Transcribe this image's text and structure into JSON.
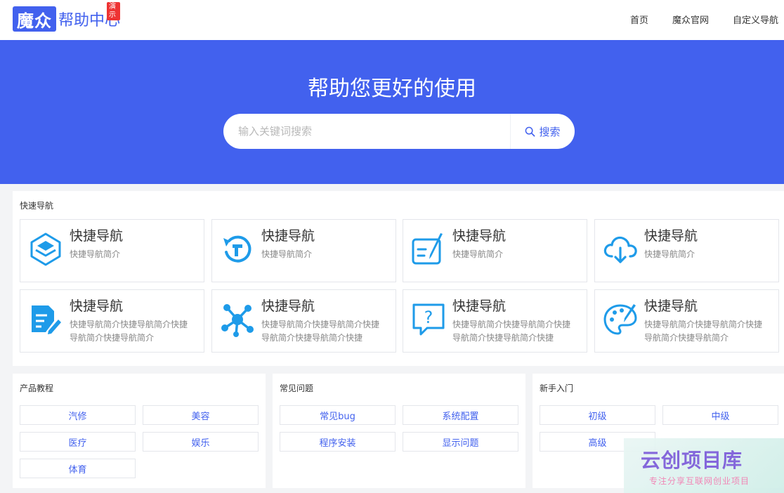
{
  "header": {
    "logo_box": "魔众",
    "logo_text": "帮助中心",
    "logo_badge": "演示",
    "nav": [
      "首页",
      "魔众官网",
      "自定义导航"
    ]
  },
  "hero": {
    "title": "帮助您更好的使用",
    "search_placeholder": "输入关键词搜索",
    "search_button": "搜索"
  },
  "quick_nav": {
    "title": "快速导航",
    "cards": [
      {
        "title": "快捷导航",
        "desc": "快捷导航简介",
        "icon": "layers-icon"
      },
      {
        "title": "快捷导航",
        "desc": "快捷导航简介",
        "icon": "refresh-icon"
      },
      {
        "title": "快捷导航",
        "desc": "快捷导航简介",
        "icon": "edit-form-icon"
      },
      {
        "title": "快捷导航",
        "desc": "快捷导航简介",
        "icon": "cloud-download-icon"
      },
      {
        "title": "快捷导航",
        "desc": "快捷导航简介快捷导航简介快捷导航简介快捷导航简介",
        "icon": "document-pen-icon"
      },
      {
        "title": "快捷导航",
        "desc": "快捷导航简介快捷导航简介快捷导航简介快捷导航简介快捷",
        "icon": "network-icon"
      },
      {
        "title": "快捷导航",
        "desc": "快捷导航简介快捷导航简介快捷导航简介快捷导航简介快捷",
        "icon": "question-bubble-icon"
      },
      {
        "title": "快捷导航",
        "desc": "快捷导航简介快捷导航简介快捷导航简介快捷导航简介",
        "icon": "palette-icon"
      }
    ]
  },
  "panels": [
    {
      "title": "产品教程",
      "tags": [
        "汽修",
        "美容",
        "医疗",
        "娱乐",
        "体育"
      ]
    },
    {
      "title": "常见问题",
      "tags": [
        "常见bug",
        "系统配置",
        "程序安装",
        "显示问题"
      ]
    },
    {
      "title": "新手入门",
      "tags": [
        "初级",
        "中级",
        "高级"
      ]
    }
  ],
  "watermark": {
    "big": "云创项目库",
    "small": "专注分享互联网创业项目"
  },
  "colors": {
    "primary": "#4261ee",
    "icon_blue": "#1e9be9",
    "badge_red": "#ee3333"
  }
}
